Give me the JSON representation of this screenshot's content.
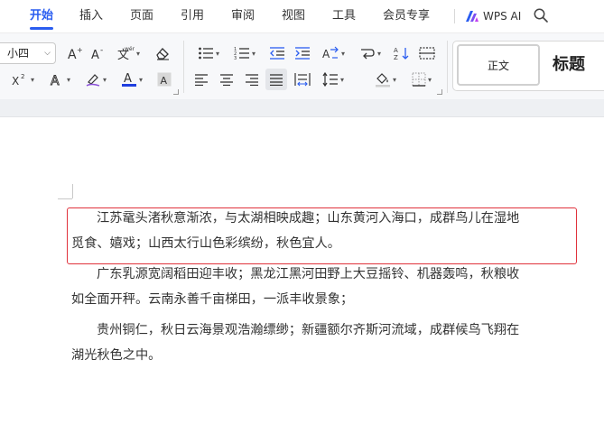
{
  "menu": {
    "tabs": [
      {
        "label": "开始",
        "active": true
      },
      {
        "label": "插入"
      },
      {
        "label": "页面"
      },
      {
        "label": "引用"
      },
      {
        "label": "审阅"
      },
      {
        "label": "视图"
      },
      {
        "label": "工具"
      },
      {
        "label": "会员专享"
      }
    ],
    "ai_label": "WPS AI"
  },
  "ribbon": {
    "font_size": "小四",
    "styles": {
      "normal": "正文",
      "heading": "标题"
    }
  },
  "document": {
    "paragraphs": [
      {
        "lines": [
          "江苏鼋头渚秋意渐浓，与太湖相映成趣；山东黄河入海口，成群鸟儿在湿地",
          "觅食、嬉戏；山西太行山色彩缤纷，秋色宜人。"
        ],
        "selected": true
      },
      {
        "lines": [
          "广东乳源宽阔稻田迎丰收；黑龙江黑河田野上大豆摇铃、机器轰鸣，秋粮收",
          "如全面开秤。云南永善千亩梯田，一派丰收景象；"
        ]
      },
      {
        "lines": [
          "贵州铜仁，秋日云海景观浩瀚缥缈；新疆额尔齐斯河流域，成群候鸟飞翔在",
          "湖光秋色之中。"
        ]
      }
    ]
  },
  "colors": {
    "accent": "#2a5df0",
    "selection_border": "#e0323c",
    "font_color_bar": "#1f3fe0"
  }
}
